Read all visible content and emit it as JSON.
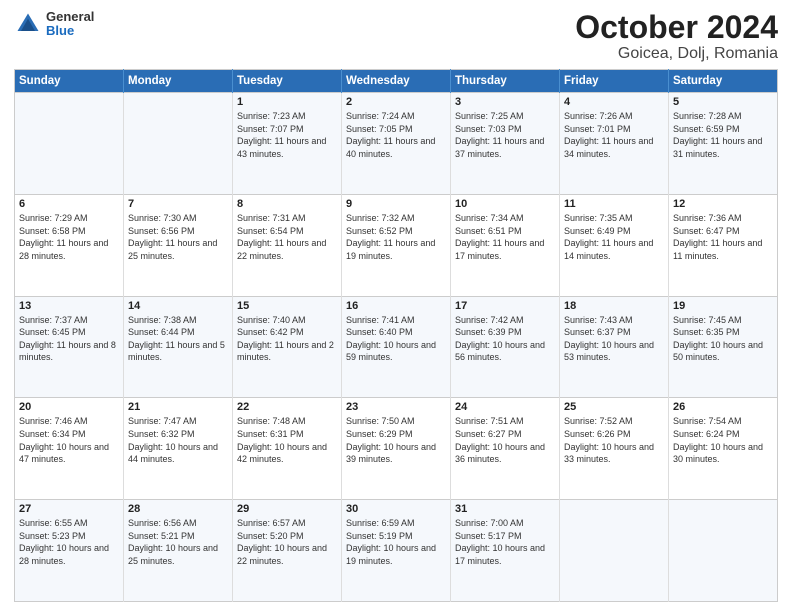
{
  "header": {
    "logo": {
      "general": "General",
      "blue": "Blue"
    },
    "title": "October 2024",
    "subtitle": "Goicea, Dolj, Romania"
  },
  "weekdays": [
    "Sunday",
    "Monday",
    "Tuesday",
    "Wednesday",
    "Thursday",
    "Friday",
    "Saturday"
  ],
  "weeks": [
    [
      {
        "day": null
      },
      {
        "day": null
      },
      {
        "day": "1",
        "sunrise": "Sunrise: 7:23 AM",
        "sunset": "Sunset: 7:07 PM",
        "daylight": "Daylight: 11 hours and 43 minutes."
      },
      {
        "day": "2",
        "sunrise": "Sunrise: 7:24 AM",
        "sunset": "Sunset: 7:05 PM",
        "daylight": "Daylight: 11 hours and 40 minutes."
      },
      {
        "day": "3",
        "sunrise": "Sunrise: 7:25 AM",
        "sunset": "Sunset: 7:03 PM",
        "daylight": "Daylight: 11 hours and 37 minutes."
      },
      {
        "day": "4",
        "sunrise": "Sunrise: 7:26 AM",
        "sunset": "Sunset: 7:01 PM",
        "daylight": "Daylight: 11 hours and 34 minutes."
      },
      {
        "day": "5",
        "sunrise": "Sunrise: 7:28 AM",
        "sunset": "Sunset: 6:59 PM",
        "daylight": "Daylight: 11 hours and 31 minutes."
      }
    ],
    [
      {
        "day": "6",
        "sunrise": "Sunrise: 7:29 AM",
        "sunset": "Sunset: 6:58 PM",
        "daylight": "Daylight: 11 hours and 28 minutes."
      },
      {
        "day": "7",
        "sunrise": "Sunrise: 7:30 AM",
        "sunset": "Sunset: 6:56 PM",
        "daylight": "Daylight: 11 hours and 25 minutes."
      },
      {
        "day": "8",
        "sunrise": "Sunrise: 7:31 AM",
        "sunset": "Sunset: 6:54 PM",
        "daylight": "Daylight: 11 hours and 22 minutes."
      },
      {
        "day": "9",
        "sunrise": "Sunrise: 7:32 AM",
        "sunset": "Sunset: 6:52 PM",
        "daylight": "Daylight: 11 hours and 19 minutes."
      },
      {
        "day": "10",
        "sunrise": "Sunrise: 7:34 AM",
        "sunset": "Sunset: 6:51 PM",
        "daylight": "Daylight: 11 hours and 17 minutes."
      },
      {
        "day": "11",
        "sunrise": "Sunrise: 7:35 AM",
        "sunset": "Sunset: 6:49 PM",
        "daylight": "Daylight: 11 hours and 14 minutes."
      },
      {
        "day": "12",
        "sunrise": "Sunrise: 7:36 AM",
        "sunset": "Sunset: 6:47 PM",
        "daylight": "Daylight: 11 hours and 11 minutes."
      }
    ],
    [
      {
        "day": "13",
        "sunrise": "Sunrise: 7:37 AM",
        "sunset": "Sunset: 6:45 PM",
        "daylight": "Daylight: 11 hours and 8 minutes."
      },
      {
        "day": "14",
        "sunrise": "Sunrise: 7:38 AM",
        "sunset": "Sunset: 6:44 PM",
        "daylight": "Daylight: 11 hours and 5 minutes."
      },
      {
        "day": "15",
        "sunrise": "Sunrise: 7:40 AM",
        "sunset": "Sunset: 6:42 PM",
        "daylight": "Daylight: 11 hours and 2 minutes."
      },
      {
        "day": "16",
        "sunrise": "Sunrise: 7:41 AM",
        "sunset": "Sunset: 6:40 PM",
        "daylight": "Daylight: 10 hours and 59 minutes."
      },
      {
        "day": "17",
        "sunrise": "Sunrise: 7:42 AM",
        "sunset": "Sunset: 6:39 PM",
        "daylight": "Daylight: 10 hours and 56 minutes."
      },
      {
        "day": "18",
        "sunrise": "Sunrise: 7:43 AM",
        "sunset": "Sunset: 6:37 PM",
        "daylight": "Daylight: 10 hours and 53 minutes."
      },
      {
        "day": "19",
        "sunrise": "Sunrise: 7:45 AM",
        "sunset": "Sunset: 6:35 PM",
        "daylight": "Daylight: 10 hours and 50 minutes."
      }
    ],
    [
      {
        "day": "20",
        "sunrise": "Sunrise: 7:46 AM",
        "sunset": "Sunset: 6:34 PM",
        "daylight": "Daylight: 10 hours and 47 minutes."
      },
      {
        "day": "21",
        "sunrise": "Sunrise: 7:47 AM",
        "sunset": "Sunset: 6:32 PM",
        "daylight": "Daylight: 10 hours and 44 minutes."
      },
      {
        "day": "22",
        "sunrise": "Sunrise: 7:48 AM",
        "sunset": "Sunset: 6:31 PM",
        "daylight": "Daylight: 10 hours and 42 minutes."
      },
      {
        "day": "23",
        "sunrise": "Sunrise: 7:50 AM",
        "sunset": "Sunset: 6:29 PM",
        "daylight": "Daylight: 10 hours and 39 minutes."
      },
      {
        "day": "24",
        "sunrise": "Sunrise: 7:51 AM",
        "sunset": "Sunset: 6:27 PM",
        "daylight": "Daylight: 10 hours and 36 minutes."
      },
      {
        "day": "25",
        "sunrise": "Sunrise: 7:52 AM",
        "sunset": "Sunset: 6:26 PM",
        "daylight": "Daylight: 10 hours and 33 minutes."
      },
      {
        "day": "26",
        "sunrise": "Sunrise: 7:54 AM",
        "sunset": "Sunset: 6:24 PM",
        "daylight": "Daylight: 10 hours and 30 minutes."
      }
    ],
    [
      {
        "day": "27",
        "sunrise": "Sunrise: 6:55 AM",
        "sunset": "Sunset: 5:23 PM",
        "daylight": "Daylight: 10 hours and 28 minutes."
      },
      {
        "day": "28",
        "sunrise": "Sunrise: 6:56 AM",
        "sunset": "Sunset: 5:21 PM",
        "daylight": "Daylight: 10 hours and 25 minutes."
      },
      {
        "day": "29",
        "sunrise": "Sunrise: 6:57 AM",
        "sunset": "Sunset: 5:20 PM",
        "daylight": "Daylight: 10 hours and 22 minutes."
      },
      {
        "day": "30",
        "sunrise": "Sunrise: 6:59 AM",
        "sunset": "Sunset: 5:19 PM",
        "daylight": "Daylight: 10 hours and 19 minutes."
      },
      {
        "day": "31",
        "sunrise": "Sunrise: 7:00 AM",
        "sunset": "Sunset: 5:17 PM",
        "daylight": "Daylight: 10 hours and 17 minutes."
      },
      {
        "day": null
      },
      {
        "day": null
      }
    ]
  ]
}
